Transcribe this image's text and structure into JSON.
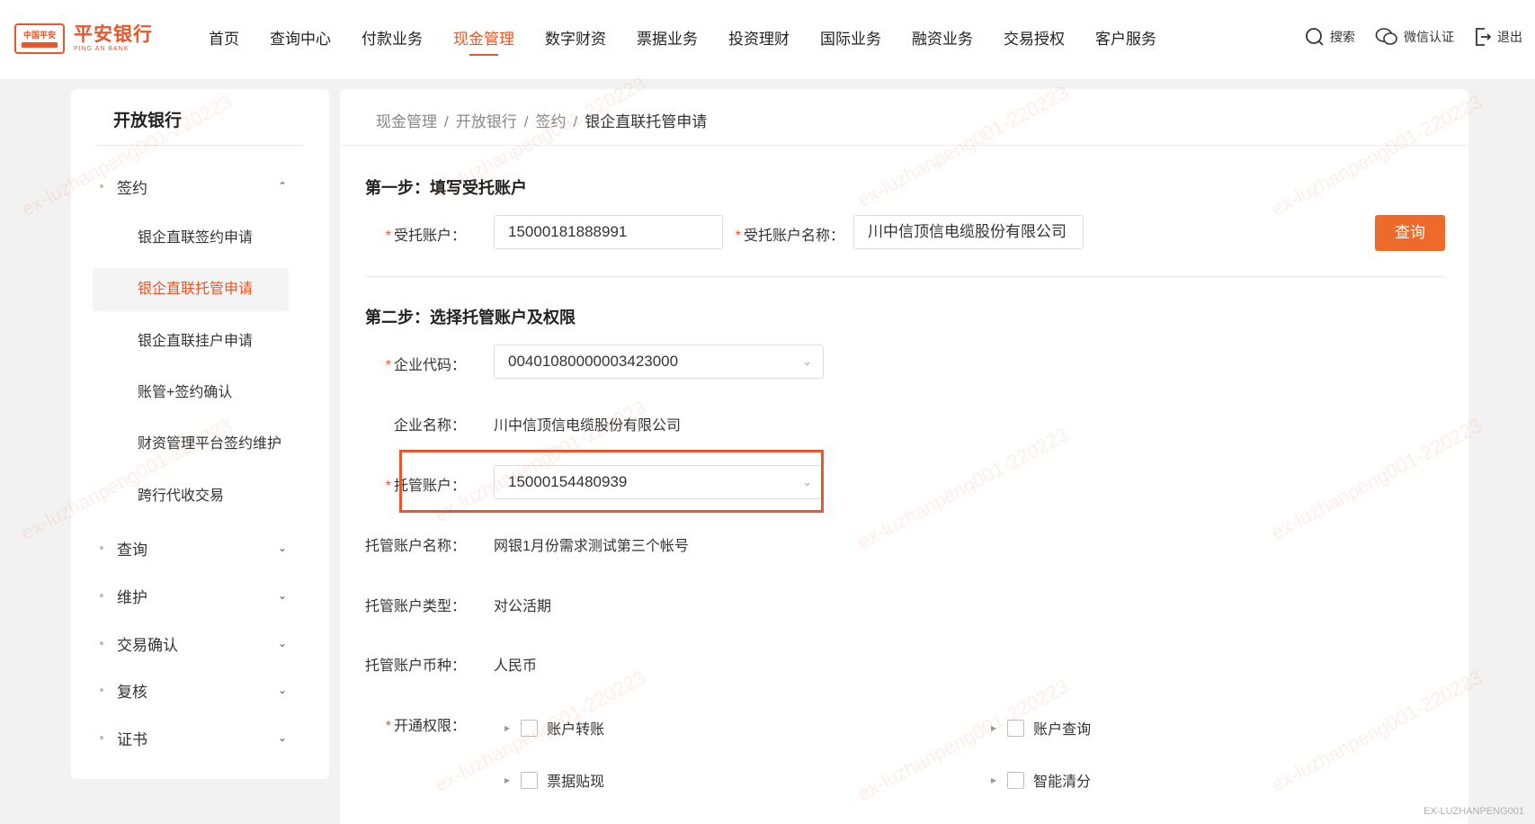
{
  "header": {
    "logo": {
      "badge_text": "中国平安",
      "name_cn": "平安银行",
      "name_en": "PING AN BANK"
    },
    "nav": [
      "首页",
      "查询中心",
      "付款业务",
      "现金管理",
      "数字财资",
      "票据业务",
      "投资理财",
      "国际业务",
      "融资业务",
      "交易授权",
      "客户服务"
    ],
    "active_nav_index": 3,
    "tools": {
      "search": "搜索",
      "wechat": "微信认证",
      "logout": "退出"
    }
  },
  "sidebar": {
    "title": "开放银行",
    "groups": [
      {
        "label": "签约",
        "expanded": true,
        "items": [
          "银企直联签约申请",
          "银企直联托管申请",
          "银企直联挂户申请",
          "账管+签约确认",
          "财资管理平台签约维护",
          "跨行代收交易"
        ],
        "active_item_index": 1
      },
      {
        "label": "查询",
        "expanded": false
      },
      {
        "label": "维护",
        "expanded": false
      },
      {
        "label": "交易确认",
        "expanded": false
      },
      {
        "label": "复核",
        "expanded": false
      },
      {
        "label": "证书",
        "expanded": false
      }
    ]
  },
  "breadcrumb": [
    "现金管理",
    "开放银行",
    "签约",
    "银企直联托管申请"
  ],
  "step1": {
    "title": "第一步：填写受托账户",
    "account_label": "受托账户：",
    "account_value": "15000181888991",
    "name_label": "受托账户名称：",
    "name_value": "川中信顶信电缆股份有限公司",
    "query_button": "查询"
  },
  "step2": {
    "title": "第二步：选择托管账户及权限",
    "code_label": "企业代码：",
    "code_value": "00401080000003423000",
    "company_label": "企业名称：",
    "company_value": "川中信顶信电缆股份有限公司",
    "custody_label": "托管账户：",
    "custody_value": "15000154480939",
    "custody_name_label": "托管账户名称：",
    "custody_name_value": "网银1月份需求测试第三个帐号",
    "custody_type_label": "托管账户类型：",
    "custody_type_value": "对公活期",
    "currency_label": "托管账户币种：",
    "currency_value": "人民币",
    "permission_label": "开通权限：",
    "permissions": [
      "账户转账",
      "账户查询",
      "票据贴现",
      "智能清分"
    ]
  },
  "watermark_text": "ex-luzhanpeng001-220223",
  "footer_user": "EX-LUZHANPENG001",
  "colors": {
    "accent": "#e8562a",
    "button": "#ee6a2a"
  }
}
